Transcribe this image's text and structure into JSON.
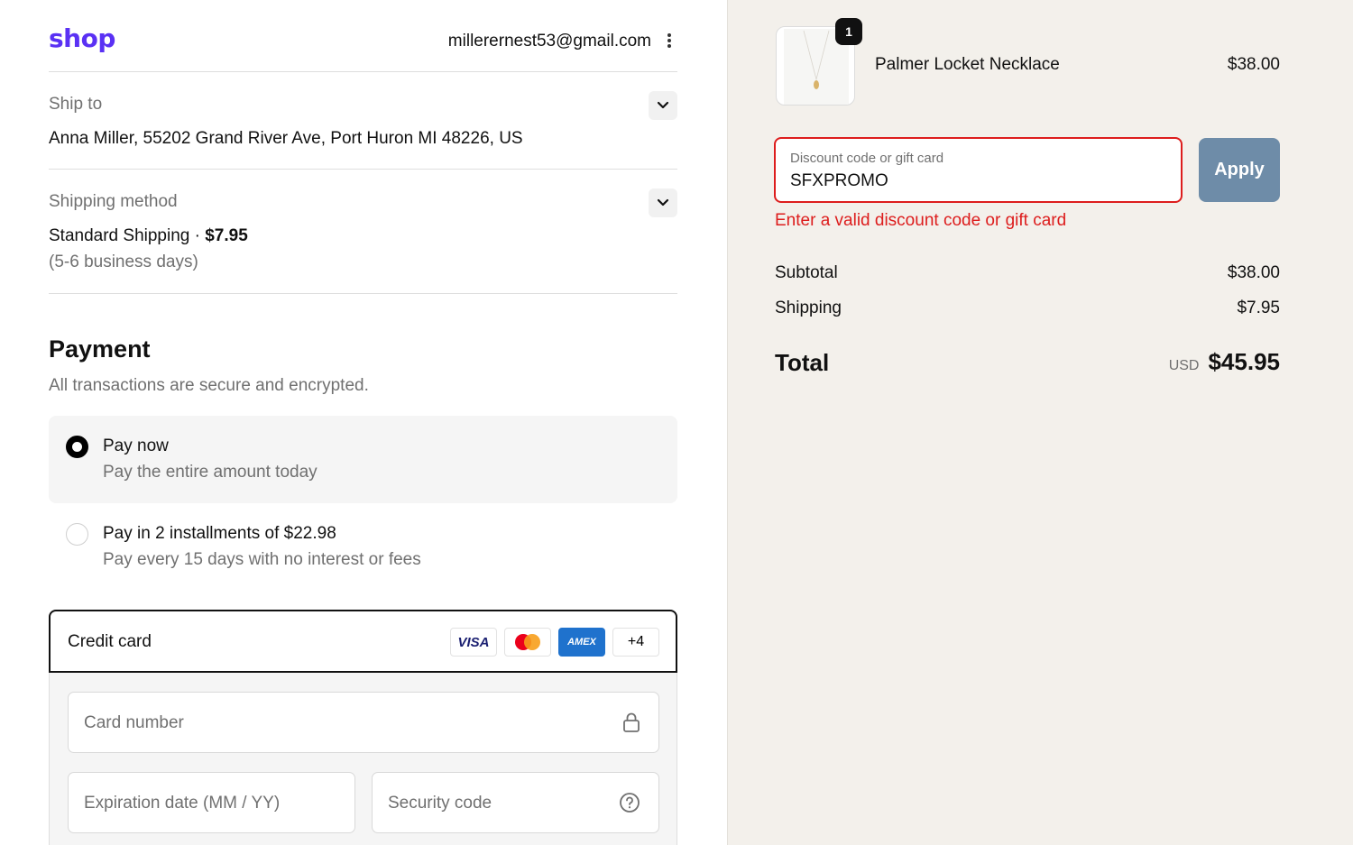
{
  "header": {
    "logo": "shop",
    "email": "millerernest53@gmail.com"
  },
  "ship_to": {
    "label": "Ship to",
    "address": "Anna Miller, 55202 Grand River Ave, Port Huron MI 48226, US"
  },
  "shipping_method": {
    "label": "Shipping method",
    "name": "Standard Shipping",
    "separator": "·",
    "price": "$7.95",
    "eta": "(5-6 business days)"
  },
  "payment": {
    "title": "Payment",
    "subtitle": "All transactions are secure and encrypted.",
    "options": [
      {
        "title": "Pay now",
        "subtitle": "Pay the entire amount today",
        "selected": true
      },
      {
        "title": "Pay in 2 installments of $22.98",
        "subtitle": "Pay every 15 days with no interest or fees",
        "selected": false
      }
    ],
    "credit_card": {
      "label": "Credit card",
      "brands": [
        "VISA",
        "Mastercard",
        "AMEX",
        "+4"
      ],
      "card_number_placeholder": "Card number",
      "expiration_placeholder": "Expiration date (MM / YY)",
      "security_code_placeholder": "Security code"
    }
  },
  "summary": {
    "item": {
      "name": "Palmer Locket Necklace",
      "price": "$38.00",
      "quantity": "1"
    },
    "discount": {
      "label": "Discount code or gift card",
      "value": "SFXPROMO",
      "apply_label": "Apply",
      "error": "Enter a valid discount code or gift card"
    },
    "subtotal_label": "Subtotal",
    "subtotal": "$38.00",
    "shipping_label": "Shipping",
    "shipping": "$7.95",
    "total_label": "Total",
    "currency": "USD",
    "total": "$45.95"
  },
  "colors": {
    "brand": "#5a31f4",
    "error": "#dd1d1d",
    "apply_button": "#6e8ca8",
    "summary_bg": "#f3f0eb"
  }
}
